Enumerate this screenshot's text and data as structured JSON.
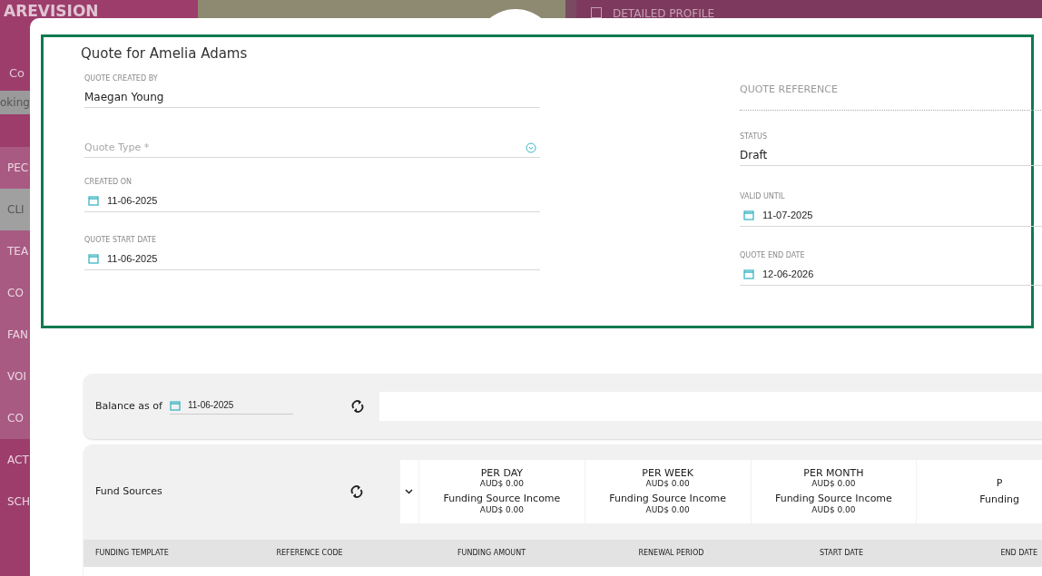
{
  "background": {
    "logo": "AREVISION",
    "detailed_profile": {
      "label": "DETAILED PROFILE",
      "checked": false
    },
    "sidebar": [
      {
        "label": "Co",
        "kind": "text"
      },
      {
        "label": "oking",
        "kind": "search"
      },
      {
        "label": "PEC",
        "kind": "item",
        "selected": false
      },
      {
        "label": "CLI",
        "kind": "item",
        "selected": true
      },
      {
        "label": "TEA",
        "kind": "item",
        "selected": false
      },
      {
        "label": "CO",
        "kind": "item",
        "selected": false
      },
      {
        "label": "FAN",
        "kind": "item",
        "selected": false
      },
      {
        "label": "VOI",
        "kind": "item",
        "selected": false
      },
      {
        "label": "CO",
        "kind": "item",
        "selected": false
      },
      {
        "label": "ACT",
        "kind": "item",
        "selected": false
      },
      {
        "label": "SCH",
        "kind": "item",
        "selected": false
      }
    ]
  },
  "quote": {
    "title": "Quote for Amelia Adams",
    "left_fields": [
      {
        "kind": "text",
        "label": "QUOTE CREATED BY",
        "value": "Maegan Young"
      },
      {
        "kind": "select",
        "placeholder": "Quote Type *"
      },
      {
        "kind": "date",
        "label": "CREATED ON",
        "value": "11-06-2025"
      },
      {
        "kind": "date",
        "label": "QUOTE START DATE",
        "value": "11-06-2025"
      }
    ],
    "right_fields": [
      {
        "kind": "reference",
        "placeholder": "QUOTE REFERENCE"
      },
      {
        "kind": "text",
        "label": "STATUS",
        "value": "Draft"
      },
      {
        "kind": "date",
        "label": "VALID UNTIL",
        "value": "11-07-2025"
      },
      {
        "kind": "date",
        "label": "QUOTE END DATE",
        "value": "12-06-2026"
      }
    ]
  },
  "balance": {
    "label": "Balance as of",
    "date": "11-06-2025"
  },
  "fund_sources": {
    "title": "Fund Sources",
    "periods": [
      {
        "title": "PER DAY",
        "amount": "AUD$ 0.00",
        "income_label": "Funding Source Income",
        "income": "AUD$ 0.00"
      },
      {
        "title": "PER WEEK",
        "amount": "AUD$ 0.00",
        "income_label": "Funding Source Income",
        "income": "AUD$ 0.00"
      },
      {
        "title": "PER MONTH",
        "amount": "AUD$ 0.00",
        "income_label": "Funding Source Income",
        "income": "AUD$ 0.00"
      },
      {
        "title": "P",
        "income_label": "Funding"
      }
    ],
    "columns": [
      "FUNDING TEMPLATE",
      "REFERENCE CODE",
      "FUNDING AMOUNT",
      "RENEWAL PERIOD",
      "START DATE",
      "END DATE"
    ]
  }
}
